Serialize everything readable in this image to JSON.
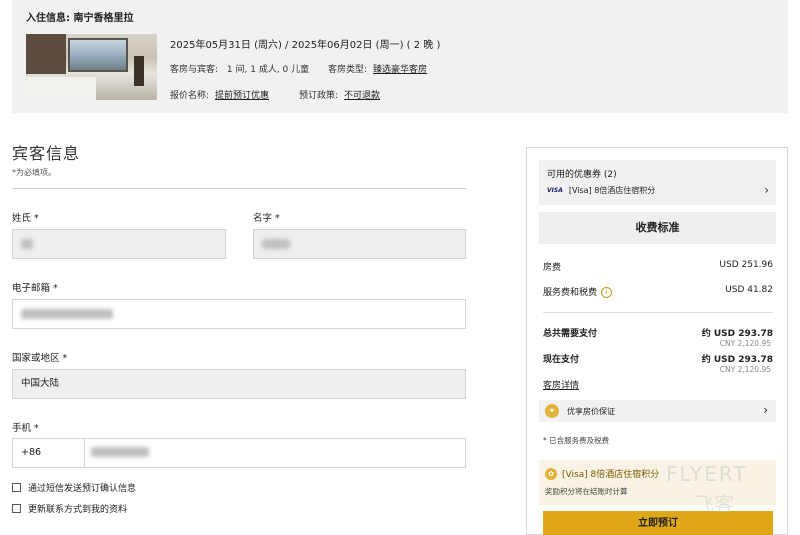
{
  "stay": {
    "title": "入住信息: 南宁香格里拉",
    "dates": "2025年05月31日 (周六) / 2025年06月02日 (周一) ( 2 晚 )",
    "rooms_guests_label": "客房与宾客:",
    "rooms_guests_value": "1 间, 1 成人, 0 儿童",
    "room_type_label": "客房类型:",
    "room_type_value": "臻选豪华客房",
    "rate_name_label": "报价名称:",
    "rate_name_value": "提前预订优惠",
    "policy_label": "预订政策:",
    "policy_value": "不可退款"
  },
  "form": {
    "title": "宾客信息",
    "required_note": "*为必填项。",
    "last_name_label": "姓氏 *",
    "first_name_label": "名字 *",
    "email_label": "电子邮箱 *",
    "country_label": "国家或地区 *",
    "country_value": "中国大陆",
    "phone_label": "手机 *",
    "phone_code": "+86",
    "sms_checkbox": "通过短信发送预订确认信息",
    "update_checkbox": "更新联系方式到我的资料"
  },
  "panel": {
    "coupon_title": "可用的优惠券 (2)",
    "coupon_card": "VISA",
    "coupon_line": "[Visa] 8倍酒店住宿积分",
    "fee_header": "收费标准",
    "room_fee_label": "房费",
    "room_fee_value": "USD 251.96",
    "service_tax_label": "服务费和税费",
    "service_tax_value": "USD 41.82",
    "total_label": "总共需要支付",
    "total_value": "约 USD 293.78",
    "total_cny": "CNY 2,120.95",
    "pay_now_label": "现在支付",
    "pay_now_value": "约 USD 293.78",
    "pay_now_cny": "CNY 2,120.95",
    "room_details": "客房详情",
    "guarantee": "优享房价保证",
    "tax_note": "* 已含服务费及税费",
    "promo_title": "[Visa] 8倍酒店住宿积分",
    "promo_sub": "奖励积分将在结账时计算",
    "book_button": "立即预订"
  },
  "watermark": {
    "line1": "FLYERT",
    "line2": "飞客"
  },
  "colors": {
    "accent": "#e0a818",
    "panel_bg": "#f3f1ef",
    "summary_bg": "#f1f1f1"
  }
}
